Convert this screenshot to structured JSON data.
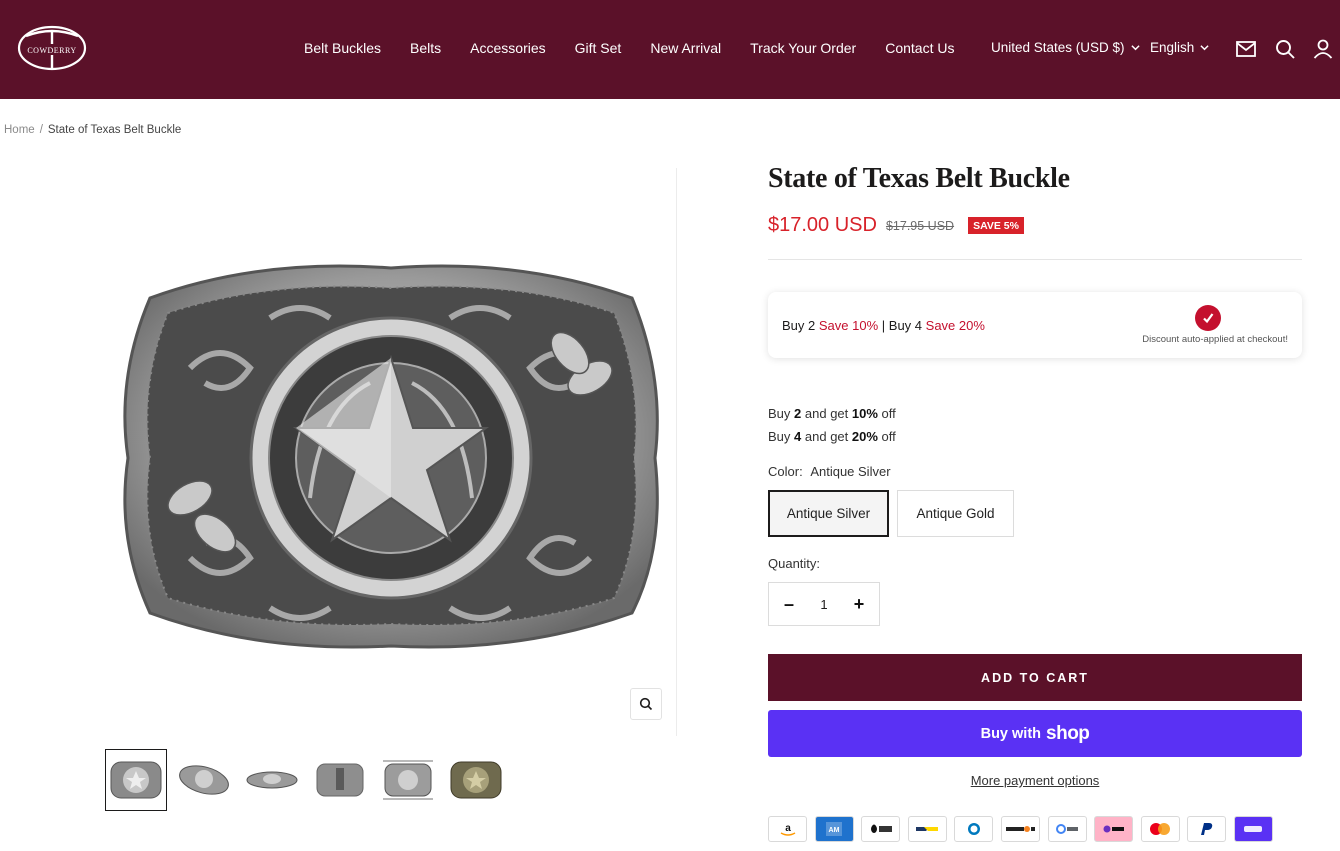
{
  "brand": {
    "name": "COWDERRY"
  },
  "nav": {
    "items": [
      "Belt Buckles",
      "Belts",
      "Accessories",
      "Gift Set",
      "New Arrival",
      "Track Your Order",
      "Contact Us"
    ]
  },
  "header": {
    "country": "United States (USD $)",
    "language": "English",
    "icons": [
      "mail-icon",
      "search-icon",
      "account-icon"
    ]
  },
  "breadcrumb": {
    "home": "Home",
    "separator": "/",
    "current": "State of Texas Belt Buckle"
  },
  "product": {
    "title": "State of Texas Belt Buckle",
    "price": "$17.00 USD",
    "compare_price": "$17.95 USD",
    "save_badge": "SAVE 5%",
    "promo": {
      "buy2": "Buy 2",
      "save10": "Save 10%",
      "sep": "|",
      "buy4": "Buy 4",
      "save20": "Save 20%",
      "note": "Discount auto-applied at checkout!"
    },
    "tiers": [
      {
        "pre": "Buy",
        "qty": "2",
        "mid": "and get",
        "pct": "10%",
        "post": "off"
      },
      {
        "pre": "Buy",
        "qty": "4",
        "mid": "and get",
        "pct": "20%",
        "post": "off"
      }
    ],
    "color_label": "Color:",
    "color_value": "Antique Silver",
    "colors": [
      "Antique Silver",
      "Antique Gold"
    ],
    "quantity_label": "Quantity:",
    "quantity": "1",
    "add_to_cart": "ADD TO CART",
    "buy_with": "Buy with",
    "shop_word": "shop",
    "more_payment": "More payment options",
    "payment_methods": [
      "amazon",
      "amex",
      "apple-pay",
      "bancontact",
      "diners",
      "discover",
      "google-pay",
      "klarna",
      "mastercard",
      "paypal",
      "shop-pay"
    ]
  },
  "colors": {
    "header_bg": "#5b1129",
    "sale_red": "#d8222a",
    "shop_purple": "#5a31f4"
  }
}
